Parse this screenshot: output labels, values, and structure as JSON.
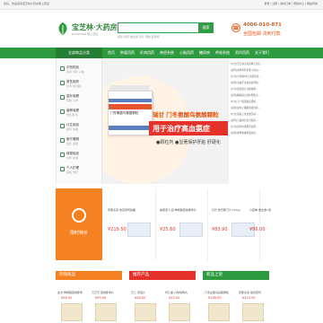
{
  "topbar": {
    "left_text": "您好，欢迎来到宝芝林大药房网上药店",
    "right_text": "登录 | 注册   |   我的订单   |   帮助中心   |   网站导航"
  },
  "header": {
    "logo_name": "宝芝林·大药房",
    "logo_sub": "BAOZHILIN  网上药店",
    "search_placeholder": "",
    "search_button": "搜索",
    "hot_words": "感冒  胃药  维生素  钙片  阿胶  避孕套",
    "phone_number": "4006-010-871",
    "phone_sub": "全国包邮 货到付款"
  },
  "nav": {
    "category_label": "全部商品分类",
    "items": [
      "首页",
      "肿瘤用药",
      "肝病用药",
      "神经系统",
      "心脑用药",
      "糖尿病",
      "呼吸系统",
      "男科用药",
      "关于我们"
    ]
  },
  "sidebar": {
    "items": [
      {
        "label": "中西药品",
        "sub": "感冒 消化 心脑"
      },
      {
        "label": "男性用药",
        "sub": "补肾 前列腺"
      },
      {
        "label": "滋补保健",
        "sub": "阿胶 人参"
      },
      {
        "label": "营养保健",
        "sub": "维生素 钙"
      },
      {
        "label": "计生用品",
        "sub": "避孕 情趣"
      },
      {
        "label": "医疗器械",
        "sub": "血压 血糖"
      },
      {
        "label": "母婴用品",
        "sub": "奶粉 护理"
      },
      {
        "label": "个人护理",
        "sub": "美容 洗护"
      }
    ]
  },
  "banner": {
    "box_text": "门冬氨酸鸟氨酸颗粒",
    "headline": "瑞甘 门冬氨酸鸟氨酸颗粒",
    "red_text": "用于治疗高血氨症",
    "features": "●颗粒剂  ●显著保护肝脏 肝硬化",
    "dots": 6,
    "active_dot": 0
  },
  "news": {
    "lines": [
      "[公告]宝芝林大药房网上药店…",
      "[资讯]春季养肝护肝小常识…",
      "[公告]全场满99元包邮活动…",
      "[资讯]高血压患者饮食须知…",
      "[公告]会员积分兑换规则…",
      "[资讯]糖尿病日常护理要点…",
      "[公告]五一假期发货通知…",
      "[资讯]如何正确服用感冒药…",
      "[公告]新品上架优惠活动…",
      "[资讯]儿童用药安全指南…",
      "[公告]货到付款服务说明…",
      "[资讯]夏季防暑降温知识…"
    ]
  },
  "offers": {
    "tag_text": "限时特价",
    "products": [
      {
        "name": "安斯泰来 他克莫司胶囊",
        "price": "¥219.50"
      },
      {
        "name": "迪赛诺 仁和 枸橼酸西地那非片",
        "price": "¥25.60"
      },
      {
        "name": "亿代 依巴斯汀片 10mg",
        "price": "¥83.90"
      },
      {
        "name": "力度伸 维生素C泡腾片",
        "price": "¥86.00"
      }
    ]
  },
  "sections": [
    {
      "title": "热销商品",
      "color": "#f58220",
      "cells": [
        {
          "name": "金戈 枸橼酸西地那非",
          "price": "¥56.50"
        },
        {
          "name": "万艾可 西地那非片",
          "price": "¥99.00"
        }
      ]
    },
    {
      "title": "推荐产品",
      "color": "#e4322b",
      "cells": [
        {
          "name": "汇仁 肾宝片",
          "price": "¥58.00"
        },
        {
          "name": "同仁堂 六味地黄丸",
          "price": "¥25.00"
        }
      ]
    },
    {
      "title": "新品上架",
      "color": "#2e9a40",
      "cells": [
        {
          "name": "门冬氨酸鸟氨酸颗粒",
          "price": "¥108.00"
        },
        {
          "name": "安斯泰来 他克莫司",
          "price": "¥219.50"
        }
      ]
    }
  ]
}
